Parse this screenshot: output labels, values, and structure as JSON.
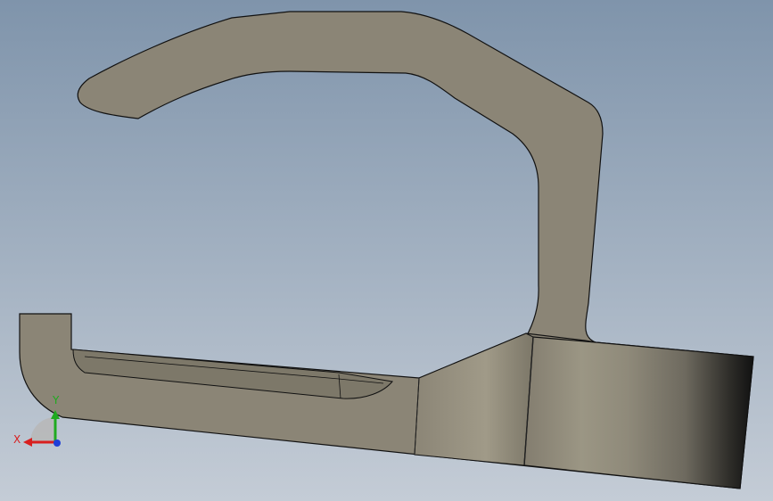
{
  "viewport": {
    "background_top": "#7f94ab",
    "background_bottom": "#c4ccd6",
    "part_color": "#8b8576",
    "edge_color": "#111111"
  },
  "triad": {
    "x_label": "X",
    "y_label": "Y",
    "x_color": "#d81f1f",
    "y_color": "#1faa1f",
    "z_color": "#1f3fd8"
  }
}
